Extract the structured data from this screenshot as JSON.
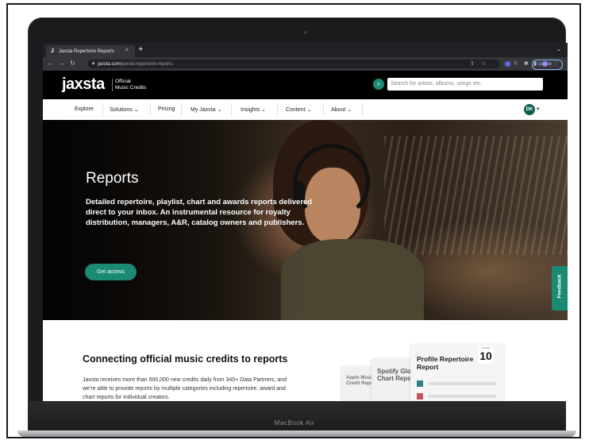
{
  "browser": {
    "tab_title": "Jaxsta Repertoire Reports",
    "tab_close": "×",
    "new_tab": "+",
    "url_domain": "jaxsta.com",
    "url_path": "/jaxsta-repertoire-reports",
    "update_label": "Update"
  },
  "site": {
    "logo": "jaxsta",
    "logo_line1": "Official",
    "logo_line2": "Music Credits",
    "search_placeholder": "Search for artists, albums, songs etc.",
    "nav": [
      "Explore",
      "Solutions",
      "Pricing",
      "My Jaxsta",
      "Insights",
      "Content",
      "About"
    ],
    "user_initials": "DK"
  },
  "hero": {
    "title": "Reports",
    "description": "Detailed repertoire, playlist, chart and awards reports delivered direct to your inbox. An instrumental resource for royalty distribution, managers, A&R, catalog owners and publishers.",
    "cta": "Get access",
    "feedback": "Feedback"
  },
  "section": {
    "title": "Connecting official music credits to reports",
    "description": "Jaxsta receives more than 500,000 new credits daily from 340+ Data Partners, and we're able to provide reports by multiple categories including repertoire, award and chart reports for individual creators.",
    "card_apple": "Apple Music Credit Report",
    "card_spotify": "Spotify Global Chart Report",
    "card_profile": "Profile Repertoire Report",
    "date_day": "Tuesday",
    "date_num": "10"
  },
  "device": {
    "label": "MacBook Air"
  },
  "colors": {
    "brand_green": "#1a8a73",
    "header_black": "#000000",
    "chip_teal": "#2f7f86",
    "chip_red": "#c6545e"
  }
}
